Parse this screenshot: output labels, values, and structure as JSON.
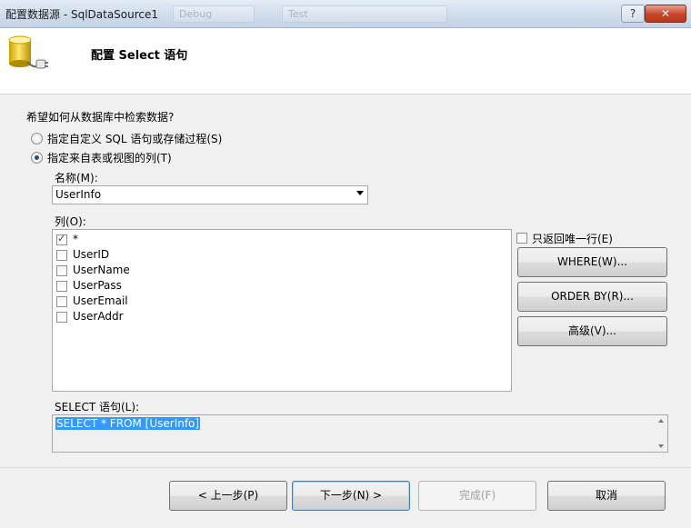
{
  "window": {
    "title": "配置数据源 - SqlDataSource1",
    "behind_toolbar": [
      "Debug",
      "Test"
    ],
    "help_button": "?",
    "close_button": "✕"
  },
  "header": {
    "title": "配置 Select 语句"
  },
  "form": {
    "question": "希望如何从数据库中检索数据?",
    "option_custom_sql": "指定自定义 SQL 语句或存储过程(S)",
    "option_columns": "指定来自表或视图的列(T)",
    "selected_option": "columns",
    "name_label": "名称(M):",
    "name_value": "UserInfo",
    "columns_label": "列(O):",
    "columns": [
      {
        "label": "*",
        "checked": true
      },
      {
        "label": "UserID",
        "checked": false
      },
      {
        "label": "UserName",
        "checked": false
      },
      {
        "label": "UserPass",
        "checked": false
      },
      {
        "label": "UserEmail",
        "checked": false
      },
      {
        "label": "UserAddr",
        "checked": false
      }
    ],
    "unique_rows_label": "只返回唯一行(E)",
    "unique_rows_checked": false,
    "where_button": "WHERE(W)...",
    "orderby_button": "ORDER BY(R)...",
    "advanced_button": "高级(V)...",
    "select_label": "SELECT 语句(L):",
    "select_statement": "SELECT * FROM [UserInfo]"
  },
  "footer": {
    "prev_button": "< 上一步(P)",
    "next_button": "下一步(N) >",
    "finish_button": "完成(F)",
    "cancel_button": "取消"
  },
  "colors": {
    "selection": "#3399ff",
    "panel": "#f0f0f0",
    "primary_border": "#3c7fb1"
  }
}
